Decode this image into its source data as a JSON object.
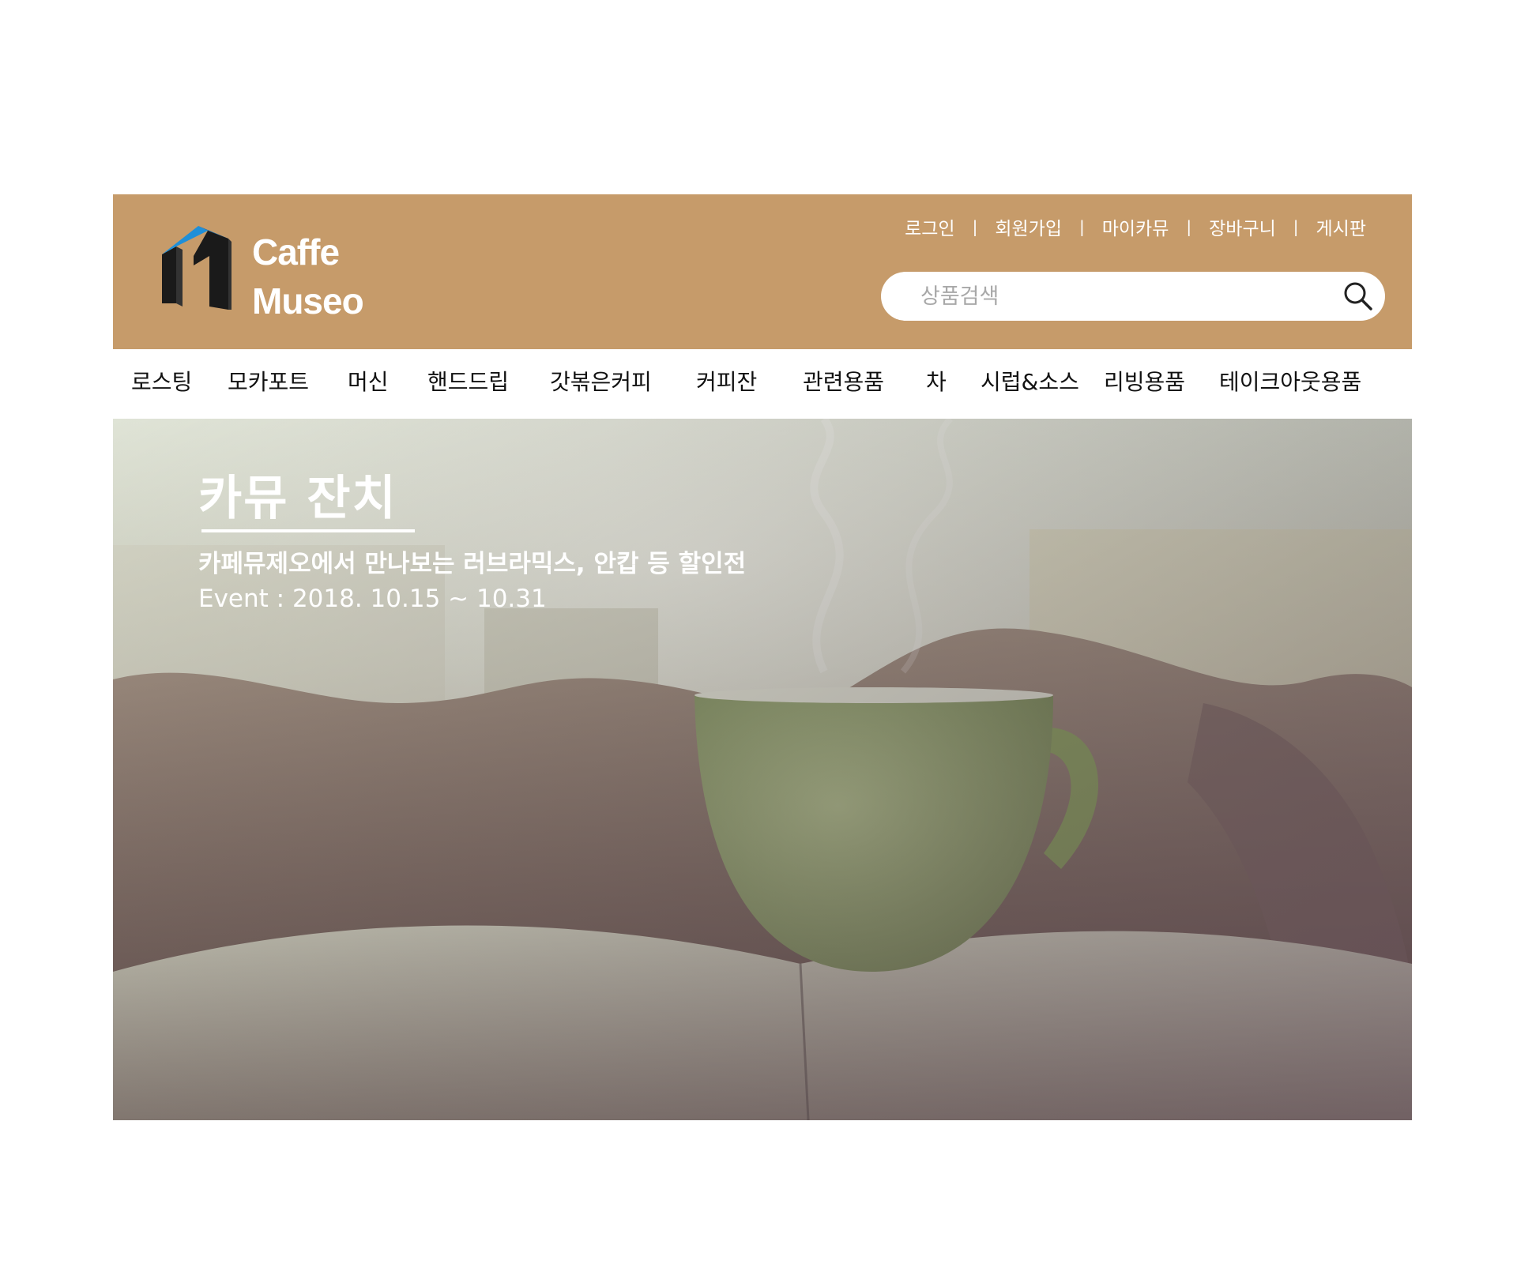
{
  "brand": {
    "name_line1": "Caffe",
    "name_line2": "Museo",
    "colors": {
      "header_bg": "#c69b6a",
      "logo_blue": "#1f8fd8",
      "logo_dark": "#1a1a1a"
    },
    "logo_icon": "house-roof-icon"
  },
  "util_links": [
    {
      "label": "로그인"
    },
    {
      "label": "회원가입"
    },
    {
      "label": "마이카뮤"
    },
    {
      "label": "장바구니"
    },
    {
      "label": "게시판"
    }
  ],
  "util_separator": "|",
  "search": {
    "placeholder": "상품검색",
    "value": "",
    "icon": "search-icon"
  },
  "nav": [
    {
      "label": "로스팅"
    },
    {
      "label": "모카포트"
    },
    {
      "label": "머신"
    },
    {
      "label": "핸드드립"
    },
    {
      "label": "갓볶은커피"
    },
    {
      "label": "커피잔"
    },
    {
      "label": "관련용품"
    },
    {
      "label": "차"
    },
    {
      "label": "시럽&소스"
    },
    {
      "label": "리빙용품"
    },
    {
      "label": "테이크아웃용품"
    }
  ],
  "banner": {
    "title": "카뮤 잔치",
    "subtitle": "카페뮤제오에서 만나보는 러브라믹스, 안캅 등 할인전",
    "date": "Event : 2018. 10.15 ~ 10.31"
  }
}
